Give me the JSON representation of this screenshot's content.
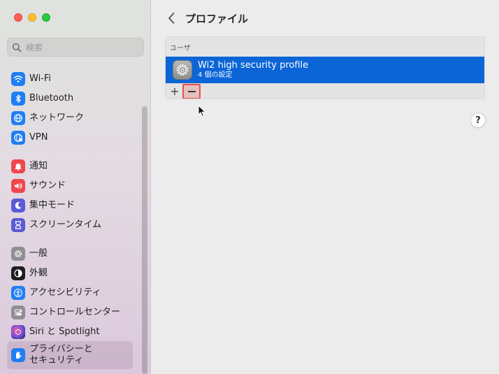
{
  "sidebar": {
    "search_placeholder": "検索",
    "items": [
      {
        "label": "Wi-Fi",
        "icon": "wifi-icon",
        "color": "#1f7ef3"
      },
      {
        "label": "Bluetooth",
        "icon": "bluetooth-icon",
        "color": "#1f7ef3"
      },
      {
        "label": "ネットワーク",
        "icon": "globe-icon",
        "color": "#1f7ef3"
      },
      {
        "label": "VPN",
        "icon": "vpn-icon",
        "color": "#1f7ef3"
      },
      {
        "label": "通知",
        "icon": "bell-icon",
        "color": "#f0464d"
      },
      {
        "label": "サウンド",
        "icon": "speaker-icon",
        "color": "#f0464d"
      },
      {
        "label": "集中モード",
        "icon": "moon-icon",
        "color": "#5b5bd6"
      },
      {
        "label": "スクリーンタイム",
        "icon": "hourglass-icon",
        "color": "#5b5bd6"
      },
      {
        "label": "一般",
        "icon": "gear-icon",
        "color": "#8e8e93"
      },
      {
        "label": "外観",
        "icon": "appearance-icon",
        "color": "#1d1d1f"
      },
      {
        "label": "アクセシビリティ",
        "icon": "accessibility-icon",
        "color": "#1f7ef3"
      },
      {
        "label": "コントロールセンター",
        "icon": "toggles-icon",
        "color": "#8e8e93"
      },
      {
        "label": "Siri と Spotlight",
        "icon": "siri-icon",
        "color": "#6b4fd8"
      },
      {
        "label": "プライバシーと\nセキュリティ",
        "icon": "hand-icon",
        "color": "#1f7ef3"
      }
    ]
  },
  "main": {
    "title": "プロファイル",
    "section_header": "ユーザ",
    "profile": {
      "name": "Wi2 high security profile",
      "subtitle": "4 個の設定"
    },
    "toolbar": {
      "add_label": "+"
    },
    "help_label": "?"
  },
  "colors": {
    "accent": "#0c65d6",
    "highlight": "#e5524a"
  }
}
